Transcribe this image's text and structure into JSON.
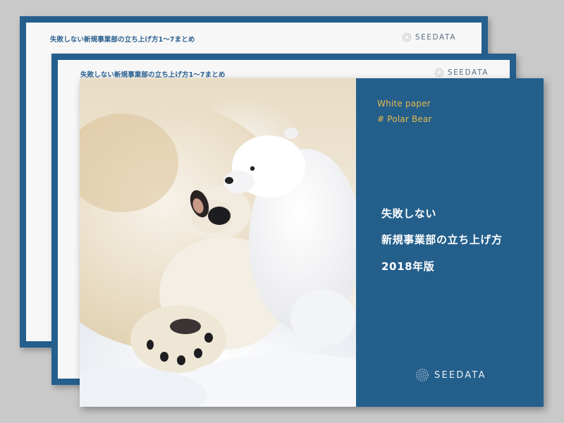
{
  "back_sheet": {
    "title": "失敗しない新規事業部の立ち上げ方1～7まとめ",
    "logo_text": "SEEDATA"
  },
  "middle_sheet": {
    "title": "失敗しない新規事業部の立ち上げ方1～7まとめ",
    "logo_text": "SEEDATA"
  },
  "cover": {
    "tag_1": "White paper",
    "tag_2": "# Polar Bear",
    "heading_line_1": "失敗しない",
    "heading_line_2": "新規事業部の立ち上げ方",
    "heading_line_3": "2018年版",
    "logo_text": "SEEDATA",
    "photo_icon": "polar-bear-photo"
  },
  "colors": {
    "background": "#c9c9c9",
    "brand_blue": "#245f8c",
    "accent_gold": "#e7b94b",
    "sheet_paper": "#f7f7f7"
  }
}
